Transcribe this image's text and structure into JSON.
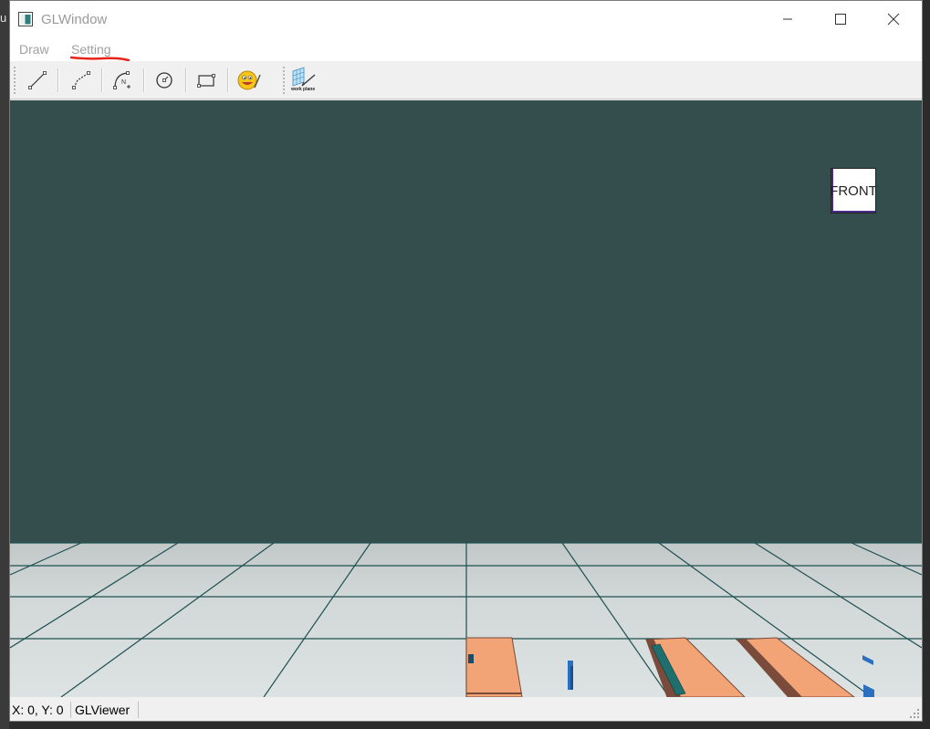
{
  "background": {
    "left_glyph": "u"
  },
  "window": {
    "title": "GLWindow",
    "controls": {
      "minimize": "minimize",
      "maximize": "maximize",
      "close": "close"
    }
  },
  "menubar": {
    "items": [
      {
        "label": "Draw"
      },
      {
        "label": "Setting"
      }
    ]
  },
  "toolbar": {
    "buttons": [
      {
        "icon": "line-icon"
      },
      {
        "icon": "polyline-icon"
      },
      {
        "icon": "curve-icon"
      },
      {
        "icon": "circle-icon"
      },
      {
        "icon": "rectangle-icon"
      },
      {
        "icon": "smiley-icon"
      },
      {
        "icon": "work-plane-icon",
        "caption": "work plane"
      }
    ]
  },
  "viewport": {
    "view_cube_label": "FRONT",
    "colors": {
      "background": "#344e4e",
      "floor": "#d6dcdc",
      "grid": "#1e5050",
      "box": "#f2a477",
      "box_side": "#7a4a3a",
      "accent": "#2a6fc0"
    }
  },
  "status": {
    "coords": "X: 0, Y: 0",
    "viewer": "GLViewer"
  },
  "annotations": {
    "color": "#e8241a"
  }
}
